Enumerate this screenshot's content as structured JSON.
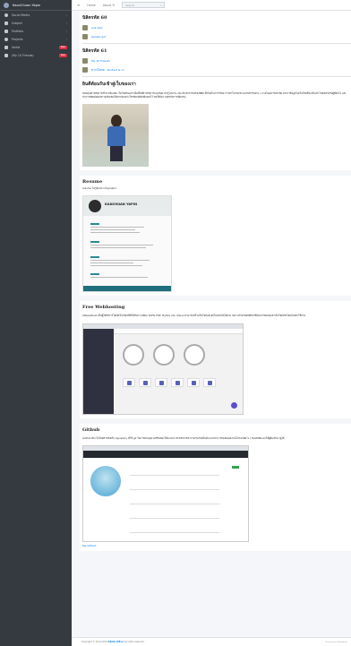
{
  "sidebar": {
    "brand": "KaanChuan Yapin",
    "items": [
      {
        "label": "Social Media",
        "icon": "circle-icon",
        "badge": ""
      },
      {
        "label": "Subject",
        "icon": "book-icon",
        "badge": ""
      },
      {
        "label": "Portfolio",
        "icon": "folder-icon",
        "badge": ""
      },
      {
        "label": "Projects",
        "icon": "circle-icon",
        "badge": ""
      },
      {
        "label": "Vertel",
        "icon": "grid-icon",
        "badge": "New"
      },
      {
        "label": "(My 10 Friends)",
        "icon": "grid-icon",
        "badge": "New"
      }
    ]
  },
  "topbar": {
    "home": "Home",
    "about": "About Yi",
    "search_placeholder": "Search"
  },
  "sections": {
    "s60": {
      "title": "นิสิตรหัส 60",
      "links": [
        "aub zam",
        "people got"
      ]
    },
    "s61": {
      "title": "นิสิตรหัส 61",
      "links": [
        "My 10 Friends",
        "ดาวน์โหลด · student & cv"
      ]
    },
    "welcome": {
      "title": "ยินดีต้อนรับเข้าสู่เว็บของเรา",
      "paragraph": "ขอบคุณสำหรับการเข้ามาเยี่ยมชม เว็บไซต์ของเราเป็นพื้นที่สำหรับการแบ่งปันความรู้ ผลงาน และประสบการณ์ของนิสิต ทั้งในด้านการเรียน การทำโปรเจกต์ และกิจกรรมต่าง ๆ ภายในมหาวิทยาลัย หวังว่าข้อมูลในเว็บไซต์นี้จะเป็นประโยชน์สำหรับผู้ที่สนใจ และสามารถติดต่อสอบถามเพิ่มเติมได้ผ่านช่องทางโซเชียลมีเดียที่แสดงไว้ ขอให้มีความสุขกับการเยี่ยมชม"
    },
    "resume": {
      "title": "Resume",
      "caption": "resume ในรูปแบบ infographic",
      "name": "KANCHUAN YAPIN"
    },
    "webhosting": {
      "title": "Free Webhosting",
      "paragraph": "000webhost เป็นผู้ให้บริการโฮสต์เว็บไซต์ฟรีที่ได้รับความนิยม รองรับ PHP, MySQL และ cPanel สามารถสร้างเว็บไซต์และอัปโหลดไฟล์ได้ง่าย เหมาะสำหรับนักศึกษาที่ต้องการทดลองทำเว็บไซต์จริงโดยไม่มีค่าใช้จ่าย",
      "app_title": "000webhost"
    },
    "github": {
      "title": "Github",
      "paragraph": "GitHub คือ เว็บไซต์สำหรับเก็บ repository ที่ใช้ git ในการควบคุมเวอร์ชันของโค้ด เหมาะสำหรับการทำงานร่วมกันเป็นทีม และสามารถแสดงผลงานโปรเจกต์ต่าง ๆ ของนักพัฒนาให้ผู้อื่นเข้ามาดูได้",
      "link": "My Github"
    }
  },
  "footer": {
    "copyright_prefix": "Copyright © 2014-2019",
    "brand": "Admin LTE.io",
    "suffix": "All rights reserved.",
    "right": "Powered by 000webhost"
  }
}
